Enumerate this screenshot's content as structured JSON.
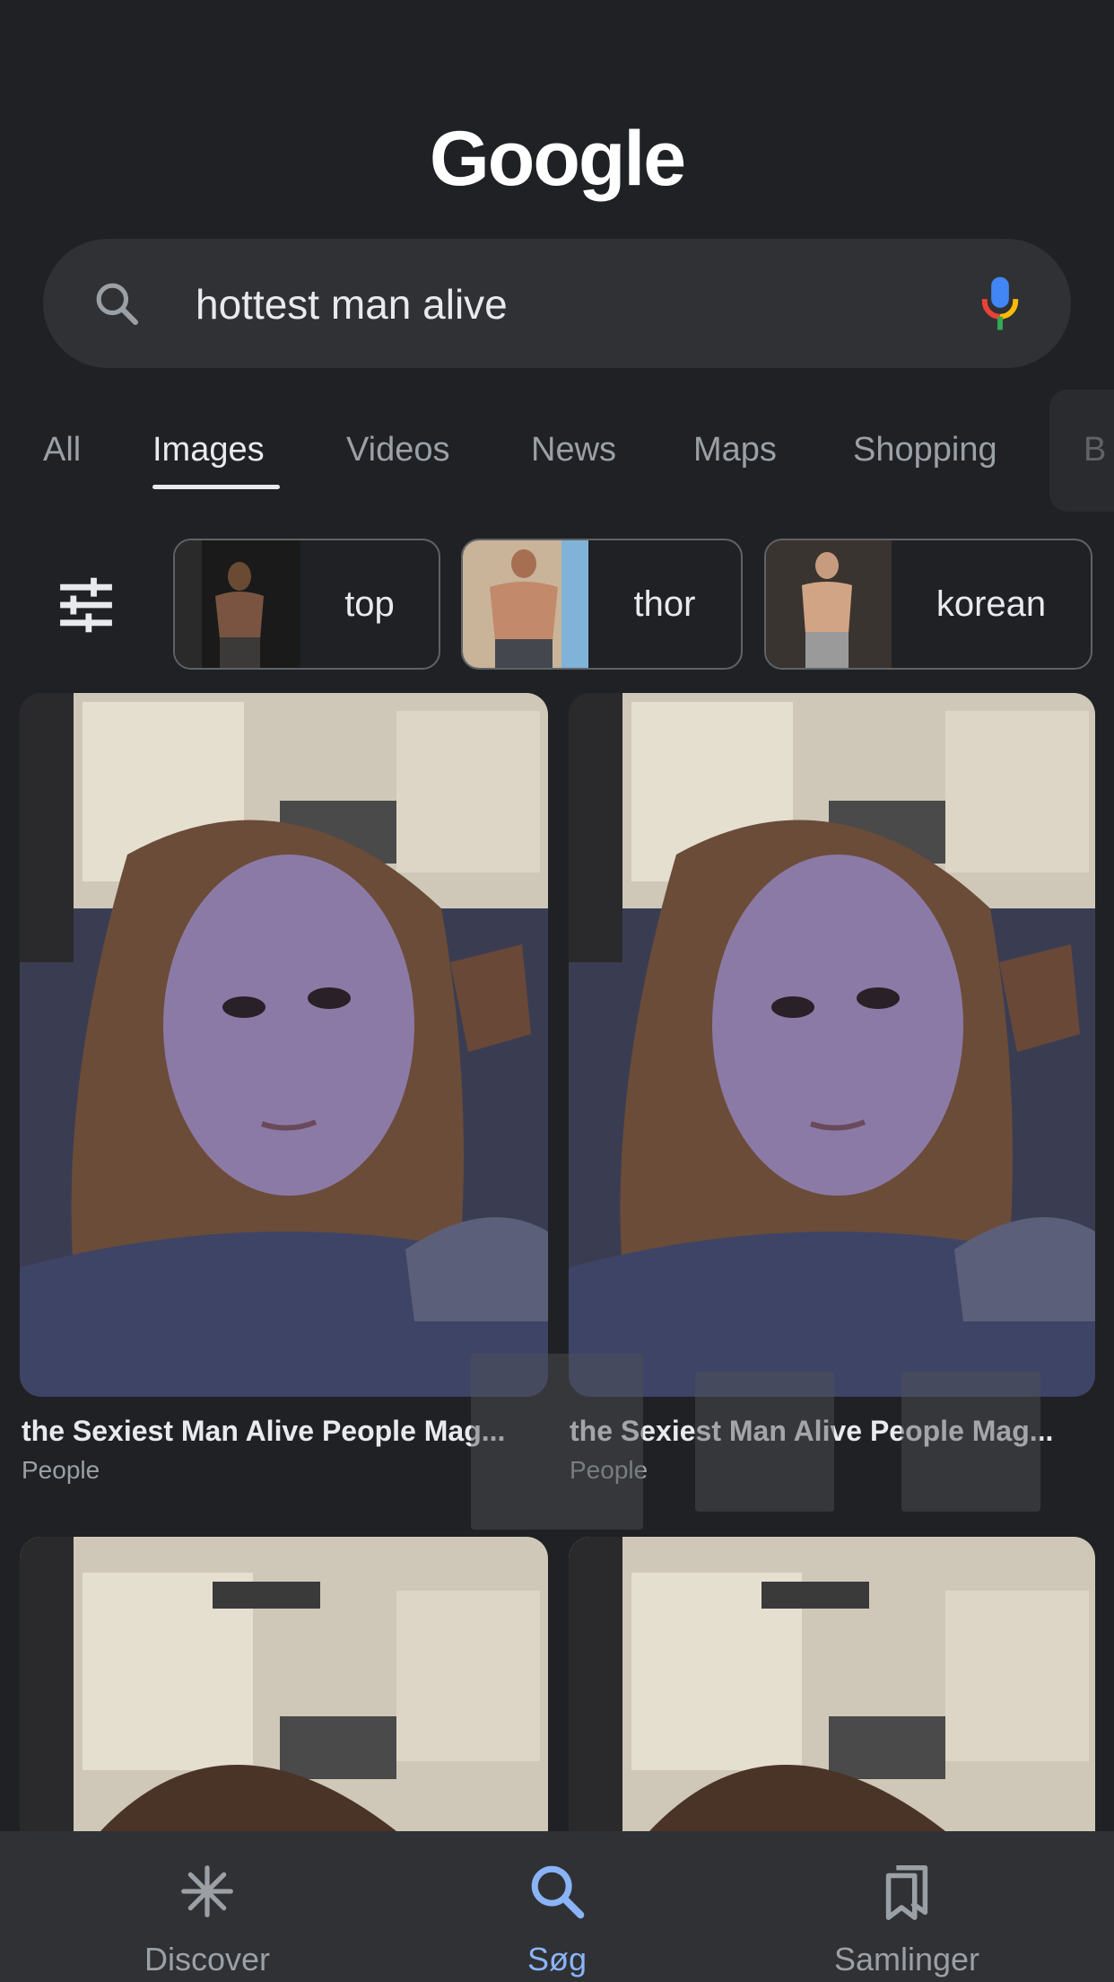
{
  "logo": "Google",
  "search": {
    "value": "hottest man alive"
  },
  "tabs": [
    {
      "label": "All"
    },
    {
      "label": "Images"
    },
    {
      "label": "Videos"
    },
    {
      "label": "News"
    },
    {
      "label": "Maps"
    },
    {
      "label": "Shopping"
    }
  ],
  "tab_partial": "B",
  "chips": [
    {
      "label": "top"
    },
    {
      "label": "thor"
    },
    {
      "label": "korean"
    }
  ],
  "results": [
    {
      "title": "the Sexiest Man Alive People Mag...",
      "source": "People"
    },
    {
      "title": "the Sexiest Man Alive People Mag...",
      "source": "People"
    }
  ],
  "bottom_nav": [
    {
      "label": "Discover"
    },
    {
      "label": "Søg"
    },
    {
      "label": "Samlinger"
    }
  ],
  "colors": {
    "background": "#202124",
    "surface": "#303134",
    "accent": "#8ab4f8"
  }
}
